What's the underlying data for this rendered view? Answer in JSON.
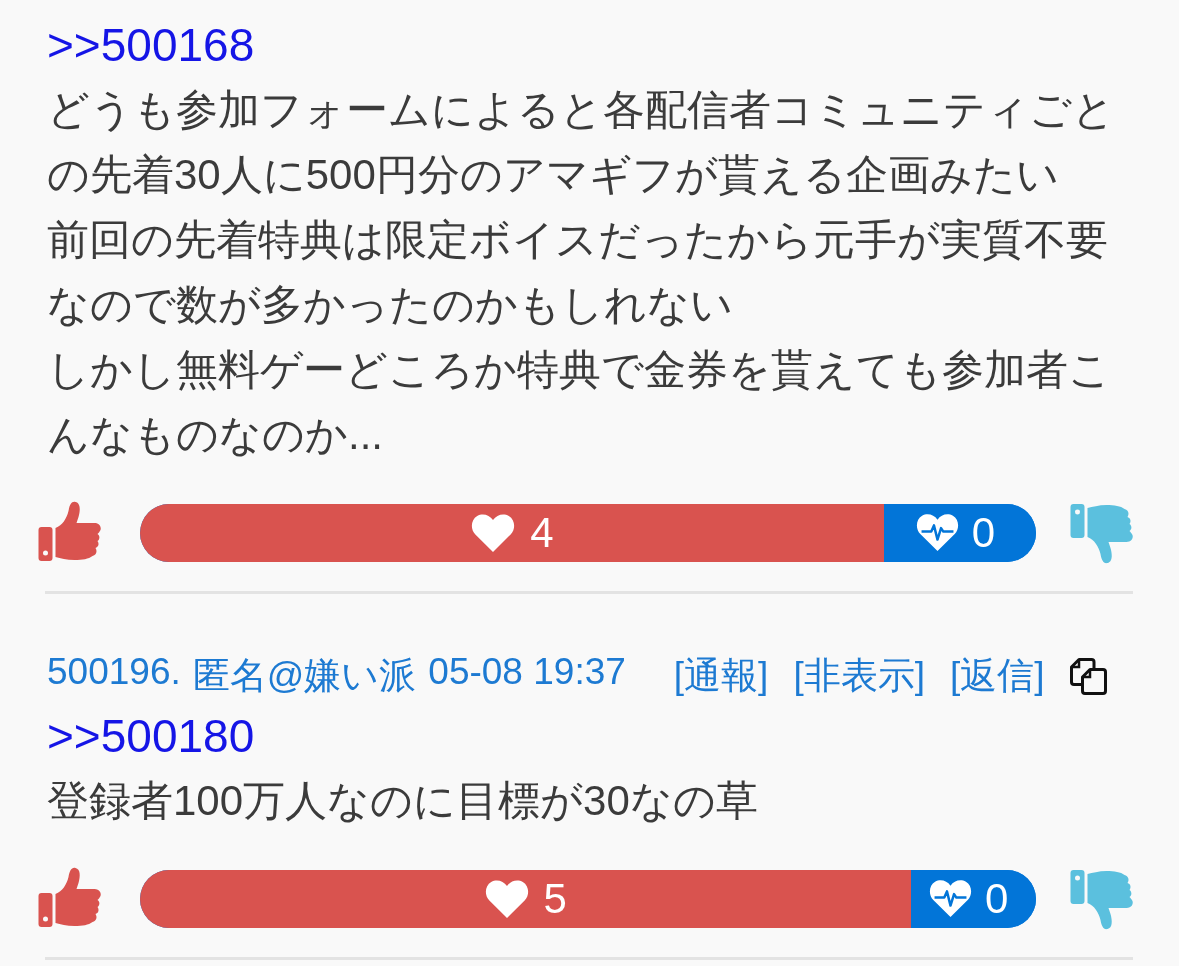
{
  "posts": [
    {
      "reply_to": ">>500168",
      "paragraphs": [
        "どうも参加フォームによると各配信者コミュニティごとの先着30人に500円分のアマギフが貰える企画みたい",
        "前回の先着特典は限定ボイスだったから元手が実質不要なので数が多かったのかもしれない",
        "しかし無料ゲーどころか特典で金券を貰えても参加者こんなものなのか..."
      ],
      "votes": {
        "likes": "4",
        "dislikes": "0",
        "level": 0.83
      }
    },
    {
      "header": {
        "number": "500196.",
        "name": "匿名@嫌い派",
        "date": "05-08 19:37",
        "actions": [
          "[通報]",
          "[非表示]",
          "[返信]"
        ]
      },
      "reply_to": ">>500180",
      "paragraphs": [
        "登録者100万人なのに目標が30なの草"
      ],
      "votes": {
        "likes": "5",
        "dislikes": "0",
        "level": 0.86
      }
    }
  ]
}
